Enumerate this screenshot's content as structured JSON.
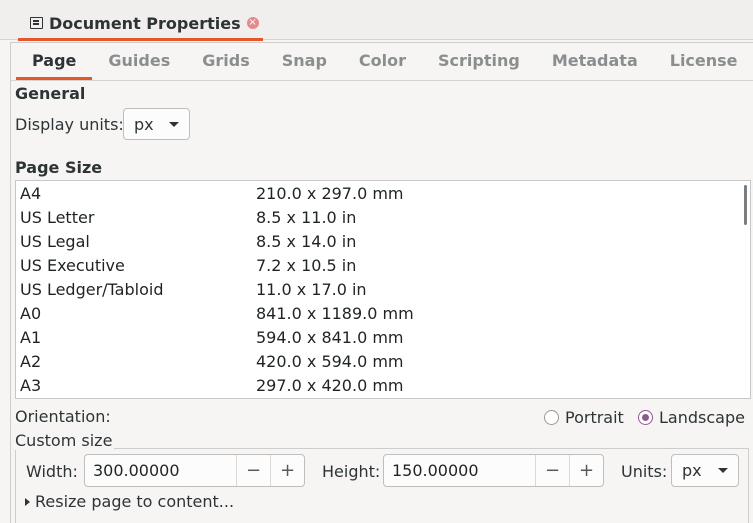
{
  "dialog": {
    "title": "Document Properties",
    "close_icon": "×"
  },
  "tabs": [
    {
      "label": "Page",
      "active": true
    },
    {
      "label": "Guides"
    },
    {
      "label": "Grids"
    },
    {
      "label": "Snap"
    },
    {
      "label": "Color"
    },
    {
      "label": "Scripting"
    },
    {
      "label": "Metadata"
    },
    {
      "label": "License"
    }
  ],
  "general": {
    "heading": "General",
    "display_units_label": "Display units:",
    "display_units_value": "px"
  },
  "page_size": {
    "heading": "Page Size",
    "rows": [
      {
        "name": "A4",
        "size": "210.0 x 297.0 mm"
      },
      {
        "name": "US Letter",
        "size": "8.5 x 11.0 in"
      },
      {
        "name": "US Legal",
        "size": "8.5 x 14.0 in"
      },
      {
        "name": "US Executive",
        "size": "7.2 x 10.5 in"
      },
      {
        "name": "US Ledger/Tabloid",
        "size": "11.0 x 17.0 in"
      },
      {
        "name": "A0",
        "size": "841.0 x 1189.0 mm"
      },
      {
        "name": "A1",
        "size": "594.0 x 841.0 mm"
      },
      {
        "name": "A2",
        "size": "420.0 x 594.0 mm"
      },
      {
        "name": "A3",
        "size": "297.0 x 420.0 mm"
      }
    ]
  },
  "orientation": {
    "label": "Orientation:",
    "portrait": "Portrait",
    "landscape": "Landscape",
    "selected": "Landscape"
  },
  "custom_size": {
    "heading": "Custom size",
    "width_label": "Width:",
    "width_value": "300.00000",
    "height_label": "Height:",
    "height_value": "150.00000",
    "minus": "−",
    "plus": "+",
    "units_label": "Units:",
    "units_value": "px",
    "resize_label": "Resize page to content..."
  }
}
